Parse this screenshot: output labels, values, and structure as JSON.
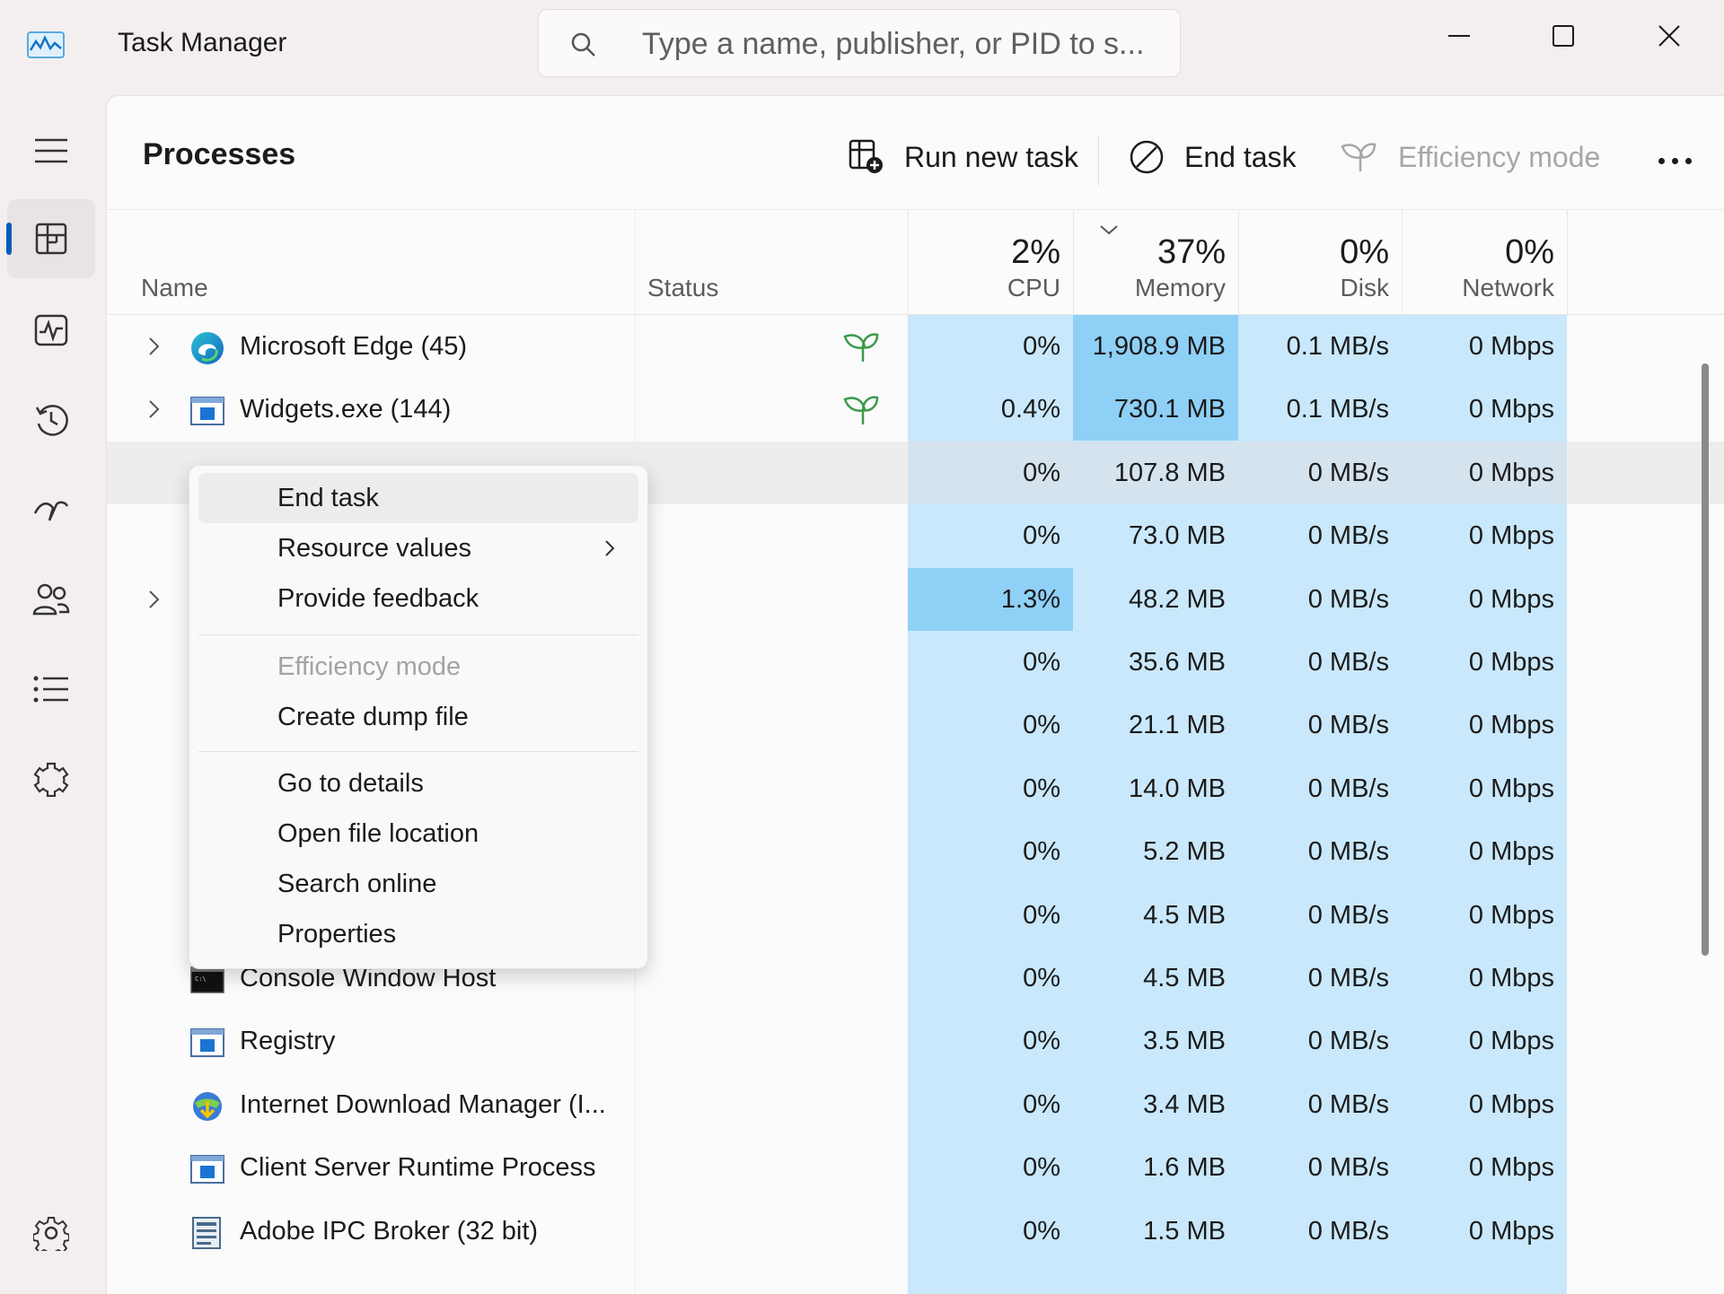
{
  "window": {
    "title": "Task Manager",
    "search_placeholder": "Type a name, publisher, or PID to s..."
  },
  "nav": {
    "items": [
      {
        "name": "hamburger-menu-icon"
      },
      {
        "name": "processes-icon",
        "active": true
      },
      {
        "name": "performance-icon"
      },
      {
        "name": "app-history-icon"
      },
      {
        "name": "startup-apps-icon"
      },
      {
        "name": "users-icon"
      },
      {
        "name": "details-icon"
      },
      {
        "name": "services-icon"
      },
      {
        "name": "settings-icon"
      }
    ]
  },
  "toolbar": {
    "page_title": "Processes",
    "run_new_task": "Run new task",
    "end_task": "End task",
    "efficiency_mode": "Efficiency mode"
  },
  "columns": {
    "name": "Name",
    "status": "Status",
    "cpu": {
      "label": "CPU",
      "percent": "2%"
    },
    "memory": {
      "label": "Memory",
      "percent": "37%"
    },
    "disk": {
      "label": "Disk",
      "percent": "0%"
    },
    "network": {
      "label": "Network",
      "percent": "0%"
    }
  },
  "rows": [
    {
      "name": "Microsoft Edge (45)",
      "icon": "edge-icon",
      "expandable": true,
      "efficiency": true,
      "cpu": "0%",
      "memory": "1,908.9 MB",
      "disk": "0.1 MB/s",
      "network": "0 Mbps"
    },
    {
      "name": "Widgets.exe (144)",
      "icon": "window-app-icon",
      "expandable": true,
      "efficiency": true,
      "cpu": "0.4%",
      "memory": "730.1 MB",
      "disk": "0.1 MB/s",
      "network": "0 Mbps"
    },
    {
      "name": "",
      "icon": "",
      "expandable": false,
      "selected": true,
      "cpu": "0%",
      "memory": "107.8 MB",
      "disk": "0 MB/s",
      "network": "0 Mbps"
    },
    {
      "name": "",
      "icon": "",
      "expandable": false,
      "cpu": "0%",
      "memory": "73.0 MB",
      "disk": "0 MB/s",
      "network": "0 Mbps"
    },
    {
      "name": "",
      "icon": "",
      "expandable": true,
      "cpu": "1.3%",
      "memory": "48.2 MB",
      "disk": "0 MB/s",
      "network": "0 Mbps"
    },
    {
      "name": "",
      "icon": "",
      "expandable": false,
      "cpu": "0%",
      "memory": "35.6 MB",
      "disk": "0 MB/s",
      "network": "0 Mbps"
    },
    {
      "name": "",
      "icon": "",
      "expandable": false,
      "cpu": "0%",
      "memory": "21.1 MB",
      "disk": "0 MB/s",
      "network": "0 Mbps"
    },
    {
      "name": "",
      "icon": "",
      "expandable": false,
      "cpu": "0%",
      "memory": "14.0 MB",
      "disk": "0 MB/s",
      "network": "0 Mbps"
    },
    {
      "name": "",
      "icon": "",
      "expandable": false,
      "cpu": "0%",
      "memory": "5.2 MB",
      "disk": "0 MB/s",
      "network": "0 Mbps"
    },
    {
      "name": "",
      "icon": "",
      "expandable": false,
      "cpu": "0%",
      "memory": "4.5 MB",
      "disk": "0 MB/s",
      "network": "0 Mbps"
    },
    {
      "name": "Console Window Host",
      "icon": "console-icon",
      "expandable": false,
      "cpu": "0%",
      "memory": "4.5 MB",
      "disk": "0 MB/s",
      "network": "0 Mbps"
    },
    {
      "name": "Registry",
      "icon": "window-app-icon",
      "expandable": false,
      "cpu": "0%",
      "memory": "3.5 MB",
      "disk": "0 MB/s",
      "network": "0 Mbps"
    },
    {
      "name": "Internet Download Manager (I...",
      "icon": "idm-icon",
      "expandable": false,
      "cpu": "0%",
      "memory": "3.4 MB",
      "disk": "0 MB/s",
      "network": "0 Mbps"
    },
    {
      "name": "Client Server Runtime Process",
      "icon": "window-app-icon",
      "expandable": false,
      "cpu": "0%",
      "memory": "1.6 MB",
      "disk": "0 MB/s",
      "network": "0 Mbps"
    },
    {
      "name": "Adobe IPC Broker (32 bit)",
      "icon": "adobe-ipc-icon",
      "expandable": false,
      "cpu": "0%",
      "memory": "1.5 MB",
      "disk": "0 MB/s",
      "network": "0 Mbps"
    }
  ],
  "context_menu": {
    "items": [
      {
        "label": "End task",
        "hover": true
      },
      {
        "label": "Resource values",
        "submenu": true
      },
      {
        "label": "Provide feedback"
      },
      {
        "separator": true
      },
      {
        "label": "Efficiency mode",
        "disabled": true
      },
      {
        "label": "Create dump file"
      },
      {
        "separator": true
      },
      {
        "label": "Go to details"
      },
      {
        "label": "Open file location"
      },
      {
        "label": "Search online"
      },
      {
        "label": "Properties"
      }
    ]
  },
  "colors": {
    "accent": "#005fb8",
    "heat_light": "#c9e8fb",
    "heat_strong": "#8fd0f7",
    "efficiency_leaf": "#3c9a4b"
  }
}
